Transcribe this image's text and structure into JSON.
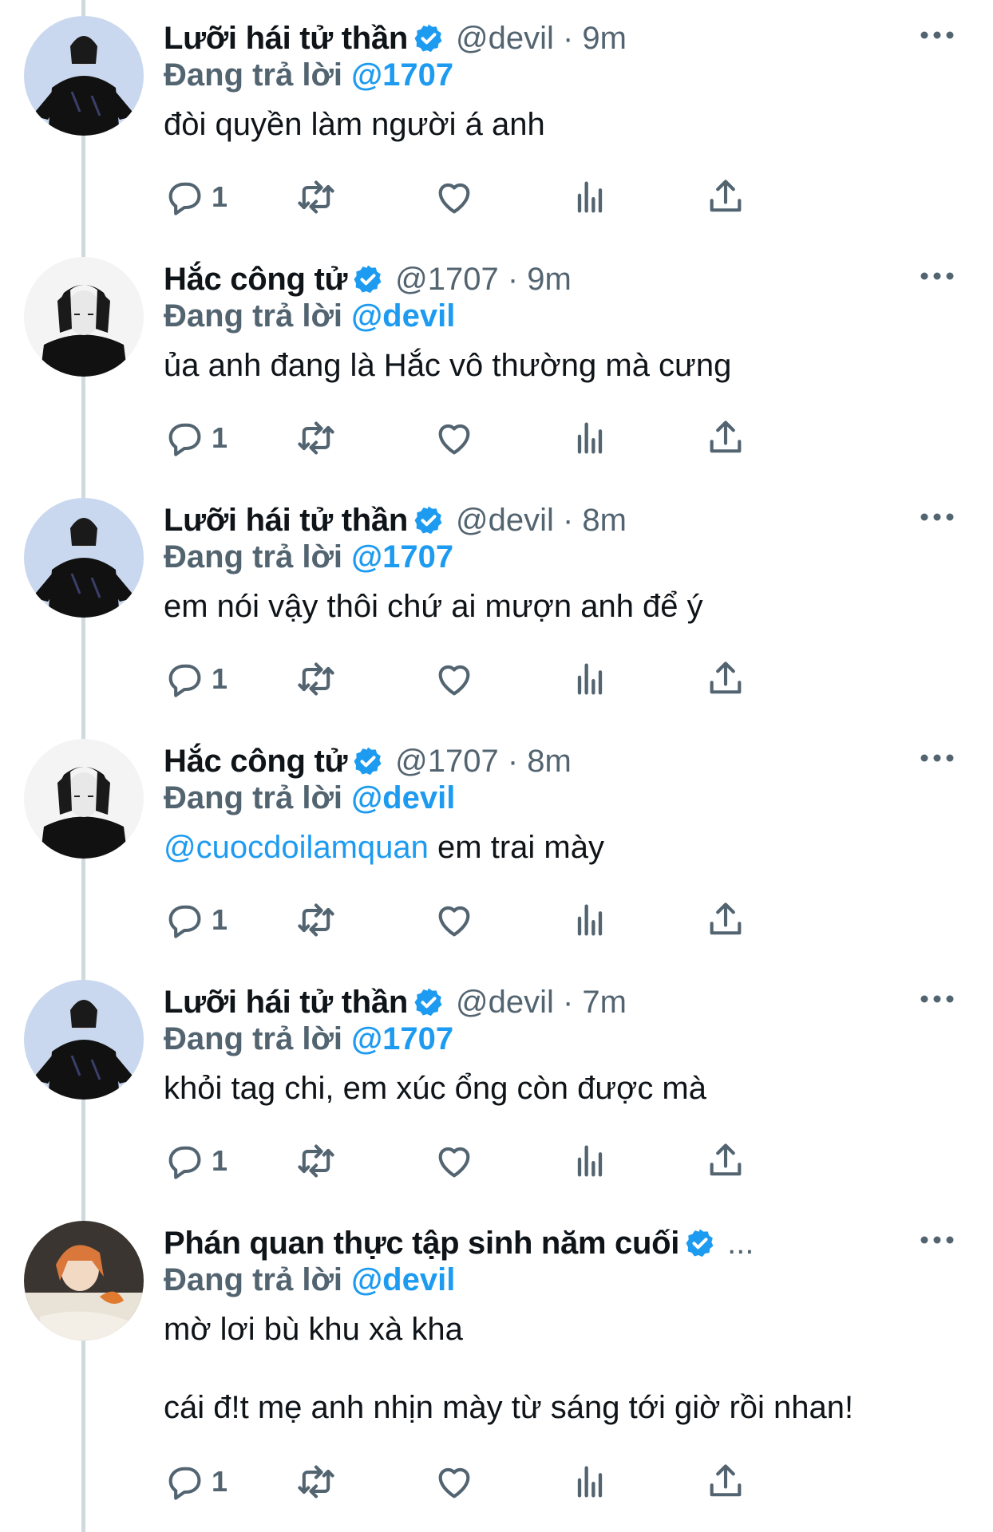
{
  "tweets": [
    {
      "name": "Lưỡi hái tử thần",
      "handle": "@devil",
      "time": "9m",
      "meta": "@devil · 9m",
      "reply_prefix": "Đang trả lời",
      "reply_to": "@1707",
      "body": [
        "đòi quyền làm người á anh"
      ],
      "reply_count": "1",
      "avatar": "avatar-dark-jacket"
    },
    {
      "name": "Hắc công tử",
      "handle": "@1707",
      "time": "9m",
      "meta": "@1707 · 9m",
      "reply_prefix": "Đang trả lời",
      "reply_to": "@devil",
      "body": [
        "ủa anh đang là Hắc vô thường mà cưng"
      ],
      "reply_count": "1",
      "avatar": "avatar-bw-hands"
    },
    {
      "name": "Lưỡi hái tử thần",
      "handle": "@devil",
      "time": "8m",
      "meta": "@devil · 8m",
      "reply_prefix": "Đang trả lời",
      "reply_to": "@1707",
      "body": [
        "em nói vậy thôi chứ ai mượn anh để ý"
      ],
      "reply_count": "1",
      "avatar": "avatar-dark-jacket"
    },
    {
      "name": "Hắc công tử",
      "handle": "@1707",
      "time": "8m",
      "meta": "@1707 · 8m",
      "reply_prefix": "Đang trả lời",
      "reply_to": "@devil",
      "body_mention": "@cuocdoilamquan",
      "body_rest": " em trai mày",
      "reply_count": "1",
      "avatar": "avatar-bw-hands"
    },
    {
      "name": "Lưỡi hái tử thần",
      "handle": "@devil",
      "time": "7m",
      "meta": "@devil · 7m",
      "reply_prefix": "Đang trả lời",
      "reply_to": "@1707",
      "body": [
        "khỏi tag chi, em xúc ổng còn được mà"
      ],
      "reply_count": "1",
      "avatar": "avatar-dark-jacket"
    },
    {
      "name": "Phán quan thực tập sinh năm cuối",
      "meta": "...",
      "reply_prefix": "Đang trả lời",
      "reply_to": "@devil",
      "body": [
        "mờ lơi bù khu xà kha",
        "cái đ!t mẹ anh nhịn mày từ sáng tới giờ rồi nhan!"
      ],
      "reply_count": "1",
      "avatar": "avatar-orange-hair"
    }
  ],
  "icons": {
    "reply": "reply-icon",
    "retweet": "retweet-icon",
    "like": "heart-icon",
    "views": "views-icon",
    "share": "share-icon",
    "more": "more-icon",
    "verified": "verified-badge-icon"
  },
  "colors": {
    "accent": "#1d9bf0",
    "secondary_text": "#536471",
    "primary_text": "#0f1419",
    "thread_line": "#cfd9de"
  }
}
